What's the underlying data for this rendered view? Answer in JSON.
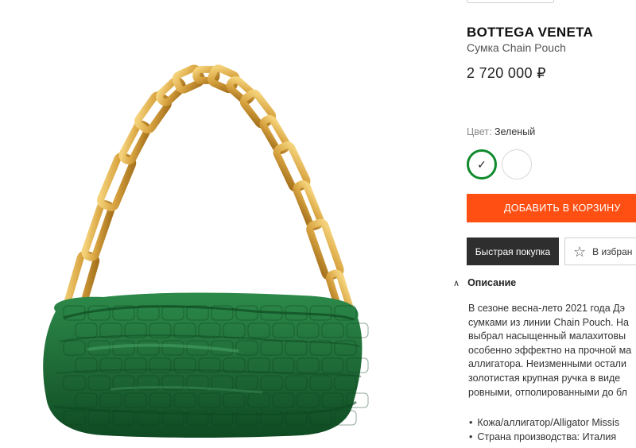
{
  "product": {
    "brand": "BOTTEGA VENETA",
    "name": "Сумка Chain Pouch",
    "price": "2 720 000 ₽",
    "color_label": "Цвет:",
    "color_value": "Зеленый",
    "swatches": [
      {
        "name": "Зеленый",
        "hex": "#0f8a2c",
        "selected": true
      },
      {
        "name": "Белый",
        "hex": "#ffffff",
        "selected": false
      }
    ],
    "check_glyph": "✓"
  },
  "actions": {
    "add_to_cart": "ДОБАВИТЬ В КОРЗИНУ",
    "quick_buy": "Быстрая покупка",
    "favorite": "В избран",
    "favorite_icon": "star-icon"
  },
  "description": {
    "header": "Описание",
    "chevron": "∧",
    "lines": [
      "В сезоне весна-лето 2021 года Дэ",
      "сумками из линии Chain Pouch. На",
      "выбрал насыщенный малахитовы",
      "особенно эффектно на прочной ма",
      "аллигатора. Неизменными остали",
      "золотистая крупная ручка в виде",
      "ровными, отполированными до бл"
    ],
    "specs": [
      "Кожа/аллигатор/Alligator Missis",
      "Страна производства: Италия"
    ]
  },
  "colors": {
    "accent": "#ff4f12",
    "dark_button": "#2e2e2e",
    "bag_green": "#1f6b37",
    "chain_gold": "#d9a441"
  }
}
